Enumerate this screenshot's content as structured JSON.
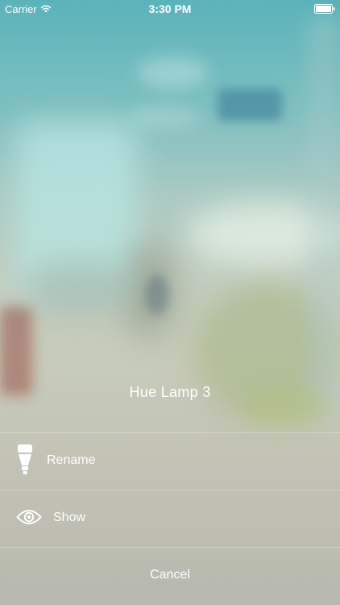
{
  "status_bar": {
    "carrier": "Carrier",
    "time": "3:30 PM",
    "wifi_icon": "wifi-icon",
    "battery_icon": "battery-full-icon"
  },
  "sheet": {
    "title": "Hue Lamp 3",
    "actions": [
      {
        "label": "Rename",
        "icon": "lamp-bulb-icon"
      },
      {
        "label": "Show",
        "icon": "eye-icon"
      }
    ],
    "cancel_label": "Cancel"
  },
  "colors": {
    "text": "#ffffff",
    "divider": "rgba(255,255,255,0.28)"
  }
}
